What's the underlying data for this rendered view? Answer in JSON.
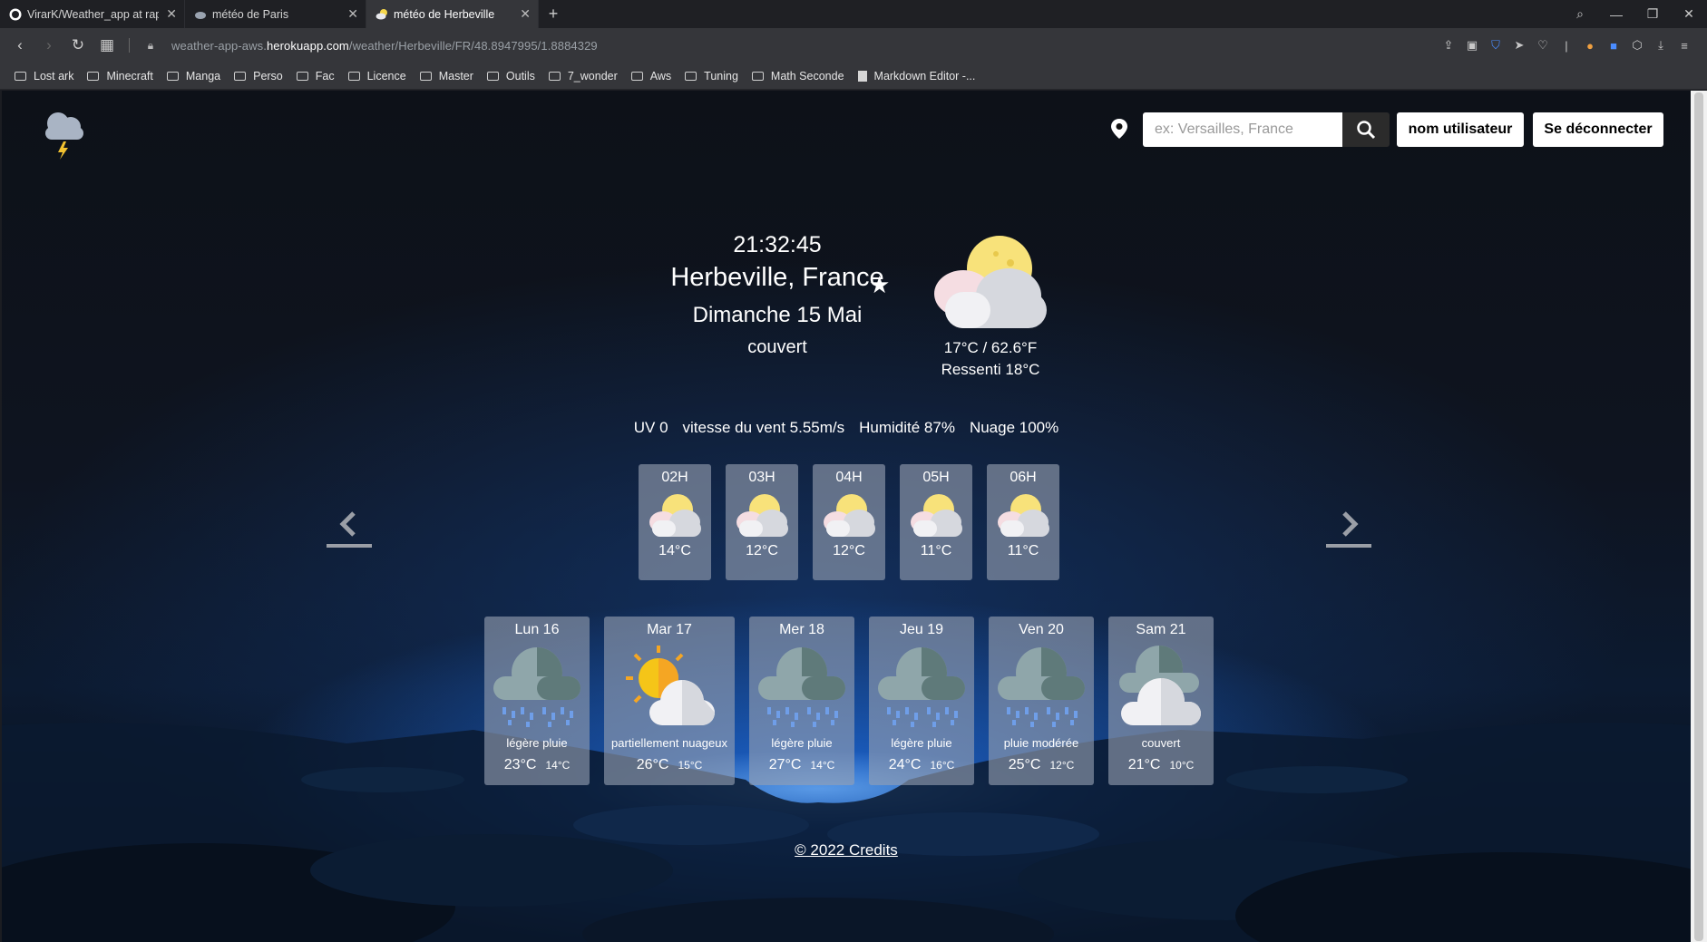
{
  "browser": {
    "tabs": [
      {
        "title": "VirarK/Weather_app at rap",
        "active": false
      },
      {
        "title": "météo de Paris",
        "active": false
      },
      {
        "title": "météo de Herbeville",
        "active": true
      }
    ],
    "url_prefix": "weather-app-aws.",
    "url_host": "herokuapp.com",
    "url_path": "/weather/Herbeville/FR/48.8947995/1.8884329",
    "bookmarks": [
      "Lost ark",
      "Minecraft",
      "Manga",
      "Perso",
      "Fac",
      "Licence",
      "Master",
      "Outils",
      "7_wonder",
      "Aws",
      "Tuning",
      "Math Seconde"
    ],
    "bookmark_doc": "Markdown Editor -..."
  },
  "header": {
    "search_placeholder": "ex: Versailles, France",
    "user_label": "nom utilisateur",
    "logout_label": "Se déconnecter"
  },
  "current": {
    "time": "21:32:45",
    "city": "Herbeville, France",
    "date": "Dimanche 15 Mai",
    "condition": "couvert",
    "temperature": "17°C / 62.6°F",
    "feels_like": "Ressenti 18°C",
    "uv": "UV 0",
    "wind": "vitesse du vent 5.55m/s",
    "humidity": "Humidité 87%",
    "clouds": "Nuage 100%"
  },
  "hourly": [
    {
      "hour": "02H",
      "temp": "14°C"
    },
    {
      "hour": "03H",
      "temp": "12°C"
    },
    {
      "hour": "04H",
      "temp": "12°C"
    },
    {
      "hour": "05H",
      "temp": "11°C"
    },
    {
      "hour": "06H",
      "temp": "11°C"
    }
  ],
  "daily": [
    {
      "day": "Lun 16",
      "summary": "légère pluie",
      "max": "23°C",
      "min": "14°C",
      "icon": "rain-icon"
    },
    {
      "day": "Mar 17",
      "summary": "partiellement nuageux",
      "max": "26°C",
      "min": "15°C",
      "icon": "sun-cloud-icon"
    },
    {
      "day": "Mer 18",
      "summary": "légère pluie",
      "max": "27°C",
      "min": "14°C",
      "icon": "rain-icon"
    },
    {
      "day": "Jeu 19",
      "summary": "légère pluie",
      "max": "24°C",
      "min": "16°C",
      "icon": "rain-icon"
    },
    {
      "day": "Ven 20",
      "summary": "pluie modérée",
      "max": "25°C",
      "min": "12°C",
      "icon": "rain-icon"
    },
    {
      "day": "Sam 21",
      "summary": "couvert",
      "max": "21°C",
      "min": "10°C",
      "icon": "overcast-icon"
    }
  ],
  "footer": {
    "credits": "© 2022 Credits"
  }
}
